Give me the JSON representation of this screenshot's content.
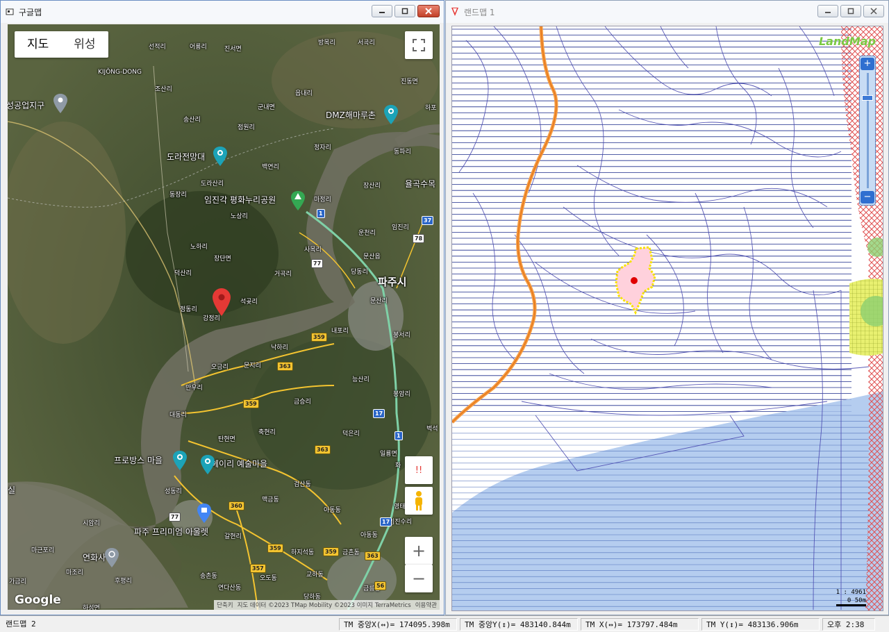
{
  "google_window": {
    "title": "구글맵",
    "map_type": {
      "map": "지도",
      "satellite": "위성"
    },
    "labels": [
      {
        "text": "선적리",
        "cls": ""
      },
      {
        "text": "어룡리",
        "cls": ""
      },
      {
        "text": "진서면",
        "cls": ""
      },
      {
        "text": "방목리",
        "cls": ""
      },
      {
        "text": "서곡리",
        "cls": ""
      },
      {
        "text": "KIJŎNG-DONG",
        "cls": ""
      },
      {
        "text": "조산리",
        "cls": ""
      },
      {
        "text": "진동면",
        "cls": ""
      },
      {
        "text": "읍내리",
        "cls": ""
      },
      {
        "text": "성공업지구",
        "cls": "big"
      },
      {
        "text": "군내면",
        "cls": ""
      },
      {
        "text": "하포",
        "cls": ""
      },
      {
        "text": "DMZ해마루촌",
        "cls": "poi"
      },
      {
        "text": "송산리",
        "cls": ""
      },
      {
        "text": "점원리",
        "cls": ""
      },
      {
        "text": "정자리",
        "cls": ""
      },
      {
        "text": "동파리",
        "cls": ""
      },
      {
        "text": "도라전망대",
        "cls": "poi"
      },
      {
        "text": "백연리",
        "cls": ""
      },
      {
        "text": "도라산리",
        "cls": ""
      },
      {
        "text": "장산리",
        "cls": ""
      },
      {
        "text": "율곡수목",
        "cls": "poi"
      },
      {
        "text": "동장리",
        "cls": ""
      },
      {
        "text": "임진각 평화누리공원",
        "cls": "poi"
      },
      {
        "text": "마정리",
        "cls": ""
      },
      {
        "text": "노상리",
        "cls": ""
      },
      {
        "text": "임진리",
        "cls": ""
      },
      {
        "text": "운천리",
        "cls": ""
      },
      {
        "text": "노하리",
        "cls": ""
      },
      {
        "text": "사목리",
        "cls": ""
      },
      {
        "text": "장단면",
        "cls": ""
      },
      {
        "text": "문산읍",
        "cls": ""
      },
      {
        "text": "덕산리",
        "cls": ""
      },
      {
        "text": "거곡리",
        "cls": ""
      },
      {
        "text": "당동리",
        "cls": ""
      },
      {
        "text": "파주시",
        "cls": "city"
      },
      {
        "text": "석곶리",
        "cls": ""
      },
      {
        "text": "정동리",
        "cls": ""
      },
      {
        "text": "강정리",
        "cls": ""
      },
      {
        "text": "문산리",
        "cls": ""
      },
      {
        "text": "내포리",
        "cls": ""
      },
      {
        "text": "봉서리",
        "cls": ""
      },
      {
        "text": "낙하리",
        "cls": ""
      },
      {
        "text": "오금리",
        "cls": ""
      },
      {
        "text": "문지리",
        "cls": ""
      },
      {
        "text": "능산리",
        "cls": ""
      },
      {
        "text": "만우리",
        "cls": ""
      },
      {
        "text": "봉암리",
        "cls": ""
      },
      {
        "text": "금승리",
        "cls": ""
      },
      {
        "text": "대동리",
        "cls": ""
      },
      {
        "text": "축현리",
        "cls": ""
      },
      {
        "text": "덕은리",
        "cls": ""
      },
      {
        "text": "탄현면",
        "cls": ""
      },
      {
        "text": "프로방스 마을",
        "cls": "poi"
      },
      {
        "text": "헤이리 예술마을",
        "cls": "poi"
      },
      {
        "text": "일룡면",
        "cls": ""
      },
      {
        "text": "검산동",
        "cls": ""
      },
      {
        "text": "성동리",
        "cls": ""
      },
      {
        "text": "맥금동",
        "cls": ""
      },
      {
        "text": "아동동",
        "cls": ""
      },
      {
        "text": "시암리",
        "cls": ""
      },
      {
        "text": "파주 프리미엄 아울렛",
        "cls": "poi"
      },
      {
        "text": "갈현리",
        "cls": ""
      },
      {
        "text": "아동동",
        "cls": ""
      },
      {
        "text": "마근포리",
        "cls": ""
      },
      {
        "text": "하지석동",
        "cls": ""
      },
      {
        "text": "금촌동",
        "cls": ""
      },
      {
        "text": "연화사",
        "cls": "poi"
      },
      {
        "text": "마조리",
        "cls": ""
      },
      {
        "text": "송촌동",
        "cls": ""
      },
      {
        "text": "오도동",
        "cls": ""
      },
      {
        "text": "교하동",
        "cls": ""
      },
      {
        "text": "가금리",
        "cls": ""
      },
      {
        "text": "후평리",
        "cls": ""
      },
      {
        "text": "연다산동",
        "cls": ""
      },
      {
        "text": "금릉동",
        "cls": ""
      },
      {
        "text": "하성면",
        "cls": ""
      },
      {
        "text": "당하동",
        "cls": ""
      },
      {
        "text": "실",
        "cls": "big"
      },
      {
        "text": "벅석",
        "cls": ""
      },
      {
        "text": "영태",
        "cls": ""
      },
      {
        "text": "임진수리",
        "cls": ""
      },
      {
        "text": "화",
        "cls": ""
      }
    ],
    "shields": [
      "1",
      "37",
      "78",
      "77",
      "359",
      "363",
      "359",
      "17",
      "1",
      "363",
      "360",
      "77",
      "17",
      "359",
      "359",
      "357",
      "363",
      "56"
    ],
    "attribution": {
      "shortcuts": "단축키",
      "data": "지도 데이터 ©2023 TMap Mobility ©2023 이미지 TerraMetrics",
      "terms": "이용약관"
    },
    "logo": "Google",
    "zoom_in": "+",
    "zoom_out": "−",
    "warning": "!!"
  },
  "landmap_window": {
    "title": "랜드맵 1",
    "logo": "LandMap",
    "scale": "1 : 4961",
    "scale_label": "0    50m",
    "zoom_in": "+",
    "zoom_out": "−"
  },
  "status": {
    "app": "랜드맵 2",
    "center_x": "TM 중앙X(↔)= 174095.398m",
    "center_y": "TM 중앙Y(↕)= 483140.844m",
    "tm_x": "TM X(↔)= 173797.484m",
    "tm_y": "TM Y(↕)= 483136.906m",
    "time": "오후 2:38"
  },
  "colors": {
    "accent": "#2f6fd0",
    "pin": "#e53935",
    "parcel": "#ffd1dc",
    "water": "#a8c4ec"
  }
}
